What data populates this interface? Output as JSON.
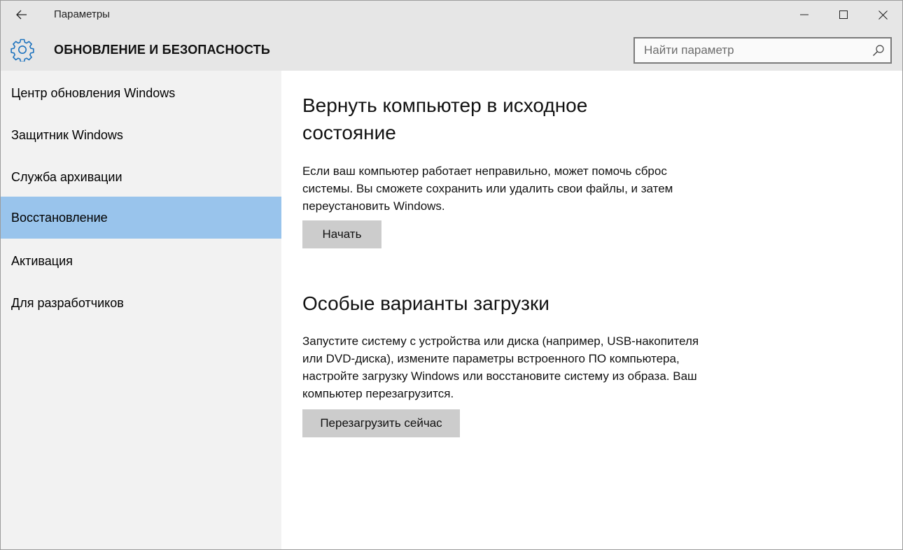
{
  "titlebar": {
    "app_title": "Параметры",
    "icons": {
      "back": "back-arrow-icon",
      "minimize": "minimize-icon",
      "maximize": "maximize-icon",
      "close": "close-icon"
    }
  },
  "header": {
    "section_title": "ОБНОВЛЕНИЕ И БЕЗОПАСНОСТЬ",
    "icon": "gear-icon",
    "search": {
      "placeholder": "Найти параметр",
      "value": ""
    }
  },
  "sidebar": {
    "items": [
      {
        "label": "Центр обновления Windows",
        "active": false
      },
      {
        "label": "Защитник Windows",
        "active": false
      },
      {
        "label": "Служба архивации",
        "active": false
      },
      {
        "label": "Восстановление",
        "active": true
      },
      {
        "label": "Активация",
        "active": false
      },
      {
        "label": "Для разработчиков",
        "active": false
      }
    ]
  },
  "main": {
    "reset": {
      "title": "Вернуть компьютер в исходное состояние",
      "description": "Если ваш компьютер работает неправильно, может помочь сброс системы. Вы сможете сохранить или удалить свои файлы, и затем переустановить Windows.",
      "button": "Начать"
    },
    "advanced": {
      "title": "Особые варианты загрузки",
      "description": "Запустите систему с устройства или диска (например, USB-накопителя или DVD-диска), измените параметры встроенного ПО компьютера, настройте загрузку Windows или восстановите систему из образа. Ваш компьютер перезагрузится.",
      "button": "Перезагрузить сейчас"
    }
  },
  "colors": {
    "accent_selected": "#99c4ec",
    "titlebar_bg": "#e6e6e6",
    "sidebar_bg": "#f2f2f2",
    "button_bg": "#cccccc"
  }
}
